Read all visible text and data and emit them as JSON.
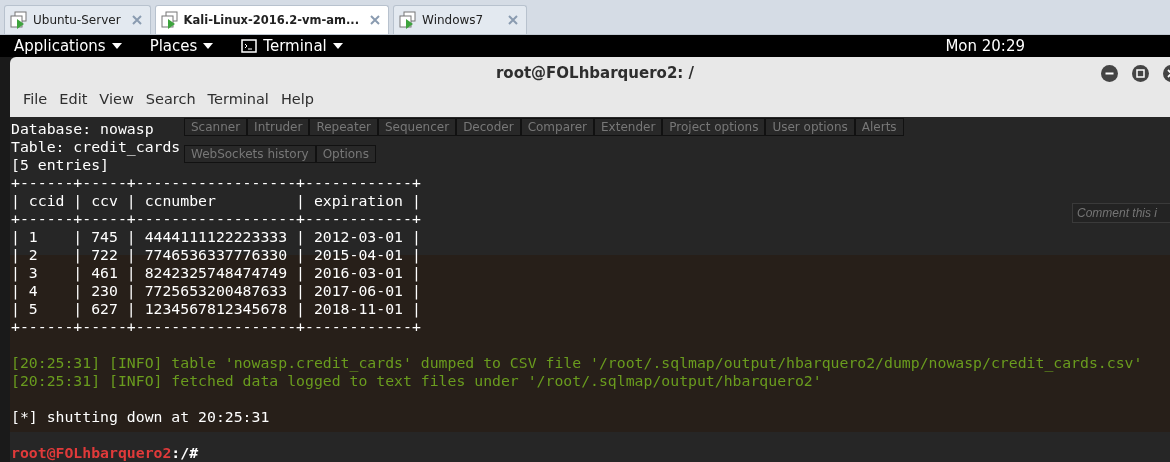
{
  "vm_tabs": [
    {
      "label": "Ubuntu-Server",
      "selected": false
    },
    {
      "label": "Kali-Linux-2016.2-vm-am...",
      "selected": true
    },
    {
      "label": "Windows7",
      "selected": false
    }
  ],
  "top_bar": {
    "menus": [
      "Applications",
      "Places",
      "Terminal"
    ],
    "clock": "Mon 20:29"
  },
  "terminal": {
    "title": "root@FOLhbarquero2: /",
    "menu": [
      "File",
      "Edit",
      "View",
      "Search",
      "Terminal",
      "Help"
    ],
    "lines": [
      {
        "kind": "plain",
        "text": "Database: nowasp"
      },
      {
        "kind": "plain",
        "text": "Table: credit_cards"
      },
      {
        "kind": "plain",
        "text": "[5 entries]"
      },
      {
        "kind": "plain",
        "text": "+------+-----+------------------+------------+"
      },
      {
        "kind": "plain",
        "text": "| ccid | ccv | ccnumber         | expiration |"
      },
      {
        "kind": "plain",
        "text": "+------+-----+------------------+------------+"
      },
      {
        "kind": "plain",
        "text": "| 1    | 745 | 4444111122223333 | 2012-03-01 |"
      },
      {
        "kind": "plain",
        "text": "| 2    | 722 | 7746536337776330 | 2015-04-01 |"
      },
      {
        "kind": "plain",
        "text": "| 3    | 461 | 8242325748474749 | 2016-03-01 |"
      },
      {
        "kind": "plain",
        "text": "| 4    | 230 | 7725653200487633 | 2017-06-01 |"
      },
      {
        "kind": "plain",
        "text": "| 5    | 627 | 1234567812345678 | 2018-11-01 |"
      },
      {
        "kind": "plain",
        "text": "+------+-----+------------------+------------+"
      },
      {
        "kind": "blank"
      },
      {
        "kind": "info",
        "text": "[20:25:31] [INFO] table 'nowasp.credit_cards' dumped to CSV file '/root/.sqlmap/output/hbarquero2/dump/nowasp/credit_cards.csv'"
      },
      {
        "kind": "info",
        "text": "[20:25:31] [INFO] fetched data logged to text files under '/root/.sqlmap/output/hbarquero2'"
      },
      {
        "kind": "blank"
      },
      {
        "kind": "plain",
        "text": "[*] shutting down at 20:25:31"
      },
      {
        "kind": "blank"
      },
      {
        "kind": "prompt",
        "user": "root@FOLhbarquero2",
        "path": ":/#"
      }
    ]
  },
  "background_app": {
    "tabs": [
      "Scanner",
      "Intruder",
      "Repeater",
      "Sequencer",
      "Decoder",
      "Comparer",
      "Extender",
      "Project options",
      "User options",
      "Alerts"
    ],
    "subtabs": [
      "WebSockets history",
      "Options"
    ],
    "comment_placeholder": "Comment this i"
  }
}
